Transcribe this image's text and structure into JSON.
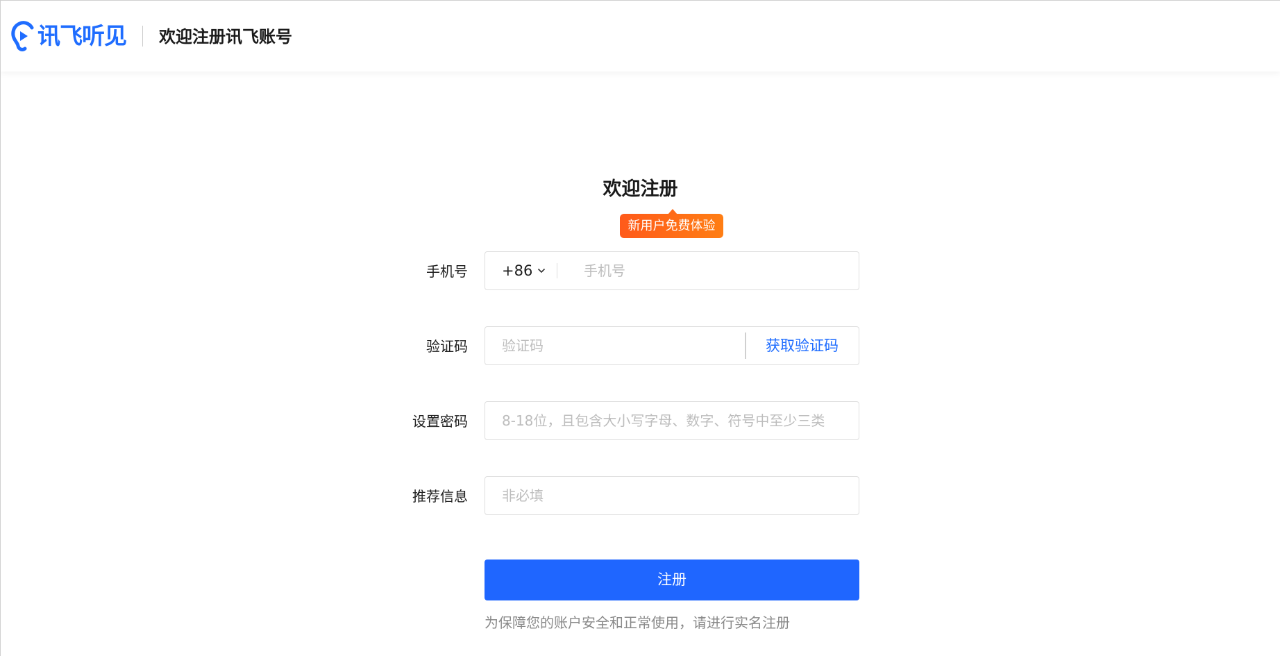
{
  "header": {
    "logo_text": "讯飞听见",
    "title": "欢迎注册讯飞账号"
  },
  "colors": {
    "brand": "#1f6dff",
    "primary_button": "#1f66ff",
    "promo_badge": "#ff6a18"
  },
  "form": {
    "heading": "欢迎注册",
    "promo_badge": "新用户免费体验",
    "phone": {
      "label": "手机号",
      "country_code": "+86",
      "placeholder": "手机号",
      "value": ""
    },
    "verification_code": {
      "label": "验证码",
      "placeholder": "验证码",
      "value": "",
      "get_code_label": "获取验证码"
    },
    "password": {
      "label": "设置密码",
      "placeholder": "8-18位，且包含大小写字母、数字、符号中至少三类",
      "value": ""
    },
    "referral": {
      "label": "推荐信息",
      "placeholder": "非必填",
      "value": ""
    },
    "submit_label": "注册",
    "notice": "为保障您的账户安全和正常使用，请进行实名注册"
  }
}
